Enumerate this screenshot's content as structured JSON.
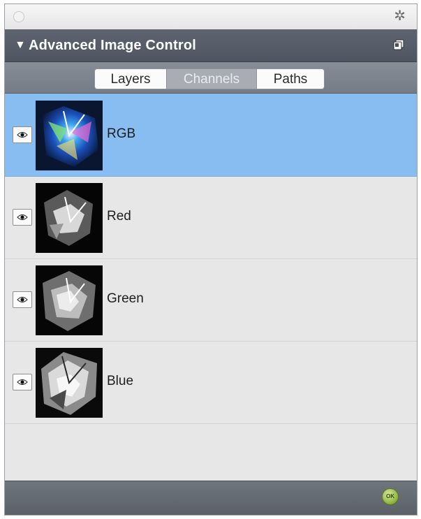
{
  "panel": {
    "title": "Advanced Image Control",
    "collapse_glyph": "▼",
    "gear_glyph": "✲"
  },
  "tabs": [
    {
      "label": "Layers",
      "active": false
    },
    {
      "label": "Channels",
      "active": true
    },
    {
      "label": "Paths",
      "active": false
    }
  ],
  "channels": [
    {
      "name": "RGB",
      "visible": true,
      "selected": true
    },
    {
      "name": "Red",
      "visible": true,
      "selected": false
    },
    {
      "name": "Green",
      "visible": true,
      "selected": false
    },
    {
      "name": "Blue",
      "visible": true,
      "selected": false
    }
  ],
  "footer": {
    "ok_label": "OK"
  },
  "colors": {
    "selection": "#88bdf2",
    "header": "#565c67",
    "tabbar": "#7e848d",
    "ok_green": "#8ab23a"
  },
  "icons": {
    "titlebar_close": "close-circle-icon",
    "settings": "gear-icon",
    "popout": "popout-icon",
    "visibility": "eye-icon"
  }
}
